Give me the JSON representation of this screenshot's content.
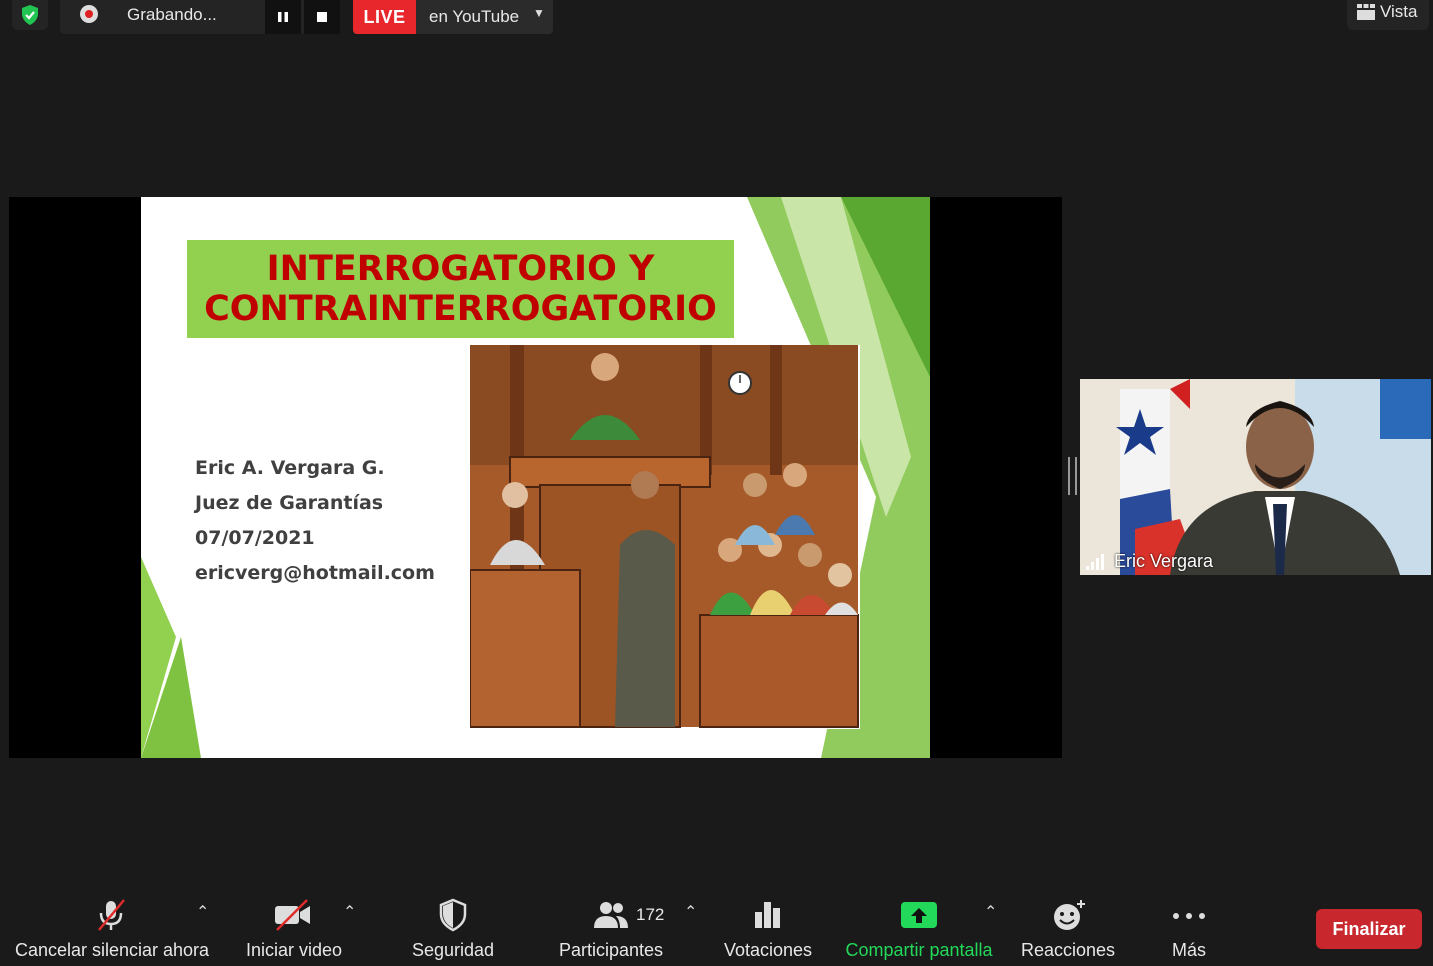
{
  "top_bar": {
    "recording_label": "Grabando...",
    "live_badge": "LIVE",
    "live_destination": "en YouTube",
    "view_label": "Vista"
  },
  "slide": {
    "title_lines": [
      "INTERROGATORIO Y",
      "CONTRAINTERROGATORIO"
    ],
    "author_lines": [
      "Eric A. Vergara G.",
      "Juez de Garantías",
      "07/07/2021",
      "ericverg@hotmail.com"
    ]
  },
  "participant_video": {
    "name": "Eric Vergara"
  },
  "toolbar": {
    "mute_label": "Cancelar silenciar ahora",
    "video_label": "Iniciar video",
    "security_label": "Seguridad",
    "participants_label": "Participantes",
    "participants_count": "172",
    "polls_label": "Votaciones",
    "share_label": "Compartir pantalla",
    "reactions_label": "Reacciones",
    "more_label": "Más",
    "end_label": "Finalizar"
  },
  "colors": {
    "share_green": "#23d959",
    "end_red": "#c8282d",
    "live_red": "#e8272c",
    "slide_title_red": "#c00000",
    "slide_title_bg": "#92d050"
  }
}
